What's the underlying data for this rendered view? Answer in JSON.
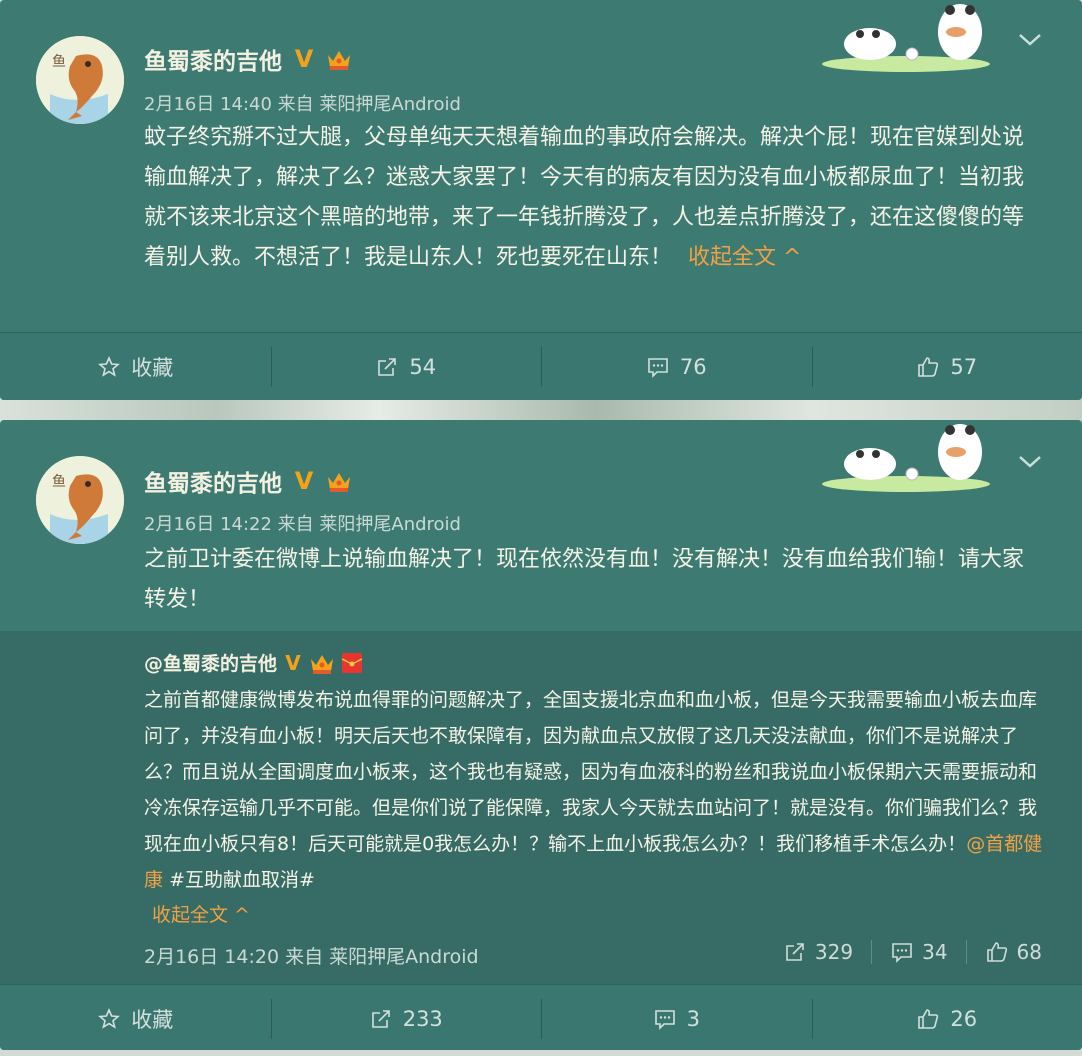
{
  "posts": [
    {
      "author": "鱼蜀黍的吉他",
      "meta": "2月16日 14:40 来自 莱阳押尾Android",
      "text": "蚊子终究掰不过大腿，父母单纯天天想着输血的事政府会解决。解决个屁！现在官媒到处说输血解决了，解决了么？迷惑大家罢了！今天有的病友有因为没有血小板都尿血了！当初我就不该来北京这个黑暗的地带，来了一年钱折腾没了，人也差点折腾没了，还在这傻傻的等着别人救。不想活了！我是山东人！死也要死在山东！",
      "collapse": "收起全文 ^",
      "actions": {
        "favorite": "收藏",
        "repost": "54",
        "comment": "76",
        "like": "57"
      }
    },
    {
      "author": "鱼蜀黍的吉他",
      "meta": "2月16日 14:22 来自 莱阳押尾Android",
      "text": "之前卫计委在微博上说输血解决了！现在依然没有血！没有解决！没有血给我们输！请大家转发！",
      "repost": {
        "author": "@鱼蜀黍的吉他",
        "text_before": "之前首都健康微博发布说血得罪的问题解决了，全国支援北京血和血小板，但是今天我需要输血小板去血库问了，并没有血小板！明天后天也不敢保障有，因为献血点又放假了这几天没法献血，你们不是说解决了么？而且说从全国调度血小板来，这个我也有疑惑，因为有血液科的粉丝和我说血小板保期六天需要振动和冷冻保存运输几乎不可能。但是你们说了能保障，我家人今天就去血站问了！就是没有。你们骗我们么？我现在血小板只有8！后天可能就是0我怎么办！？输不上血小板我怎么办？！我们移植手术怎么办！",
        "mention": "@首都健康",
        "hashtag": "#互助献血取消#",
        "collapse": "收起全文 ^",
        "meta": "2月16日 14:20 来自 莱阳押尾Android",
        "repost_count": "329",
        "comment_count": "34",
        "like_count": "68"
      },
      "actions": {
        "favorite": "收藏",
        "repost": "233",
        "comment": "3",
        "like": "26"
      }
    }
  ],
  "icons": {
    "verified": "V",
    "crown": "crown-icon",
    "red_envelope": "red-envelope-icon",
    "star": "star-icon",
    "share": "share-icon",
    "comment": "comment-icon",
    "like": "thumbs-up-icon",
    "chevron": "chevron-down-icon"
  },
  "colors": {
    "card": "#3d7a72",
    "repost_bg": "#366c65",
    "accent_orange": "#f0a144",
    "verified": "#f4a21b"
  }
}
